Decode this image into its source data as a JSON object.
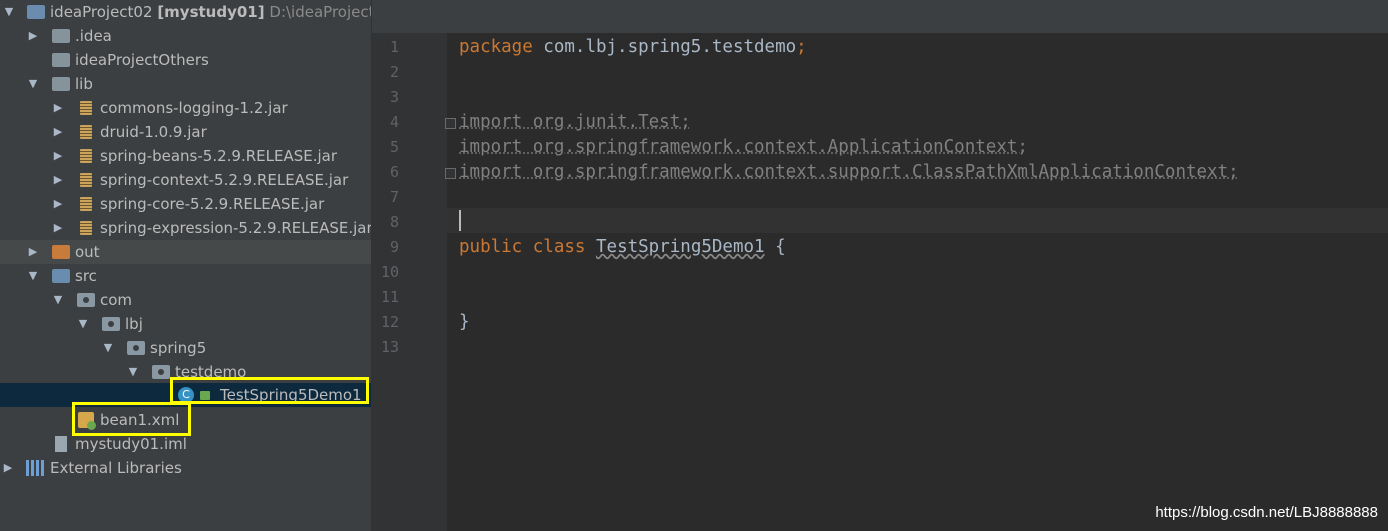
{
  "project": {
    "name": "ideaProject02",
    "module": "[mystudy01]",
    "path": "D:\\ideaProjectT"
  },
  "tree": {
    "idea": ".idea",
    "others": "ideaProjectOthers",
    "lib": "lib",
    "jars": [
      "commons-logging-1.2.jar",
      "druid-1.0.9.jar",
      "spring-beans-5.2.9.RELEASE.jar",
      "spring-context-5.2.9.RELEASE.jar",
      "spring-core-5.2.9.RELEASE.jar",
      "spring-expression-5.2.9.RELEASE.jar"
    ],
    "out": "out",
    "src": "src",
    "com": "com",
    "lbj": "lbj",
    "spring5": "spring5",
    "testdemo": "testdemo",
    "class_file": "TestSpring5Demo1",
    "bean_file": "bean1.xml",
    "iml_file": "mystudy01.iml",
    "external": "External Libraries",
    "class_icon_letter": "C"
  },
  "editor": {
    "line_numbers": [
      "1",
      "2",
      "3",
      "4",
      "5",
      "6",
      "7",
      "8",
      "9",
      "10",
      "11",
      "12",
      "13"
    ],
    "line1": {
      "kw": "package",
      "rest": " com.lbj.spring5.testdemo",
      "semi": ";"
    },
    "imports": [
      "import org.junit.Test;",
      "import org.springframework.context.ApplicationContext;",
      "import org.springframework.context.support.ClassPathXmlApplicationContext;"
    ],
    "line9": {
      "kw1": "public",
      "kw2": "class",
      "name": "TestSpring5Demo1",
      "brace": " {"
    },
    "line12": "}"
  },
  "watermark": "https://blog.csdn.net/LBJ8888888",
  "colors": {
    "highlight_box": "#ffff00",
    "keyword": "#cc7832",
    "selection": "#0d293e"
  }
}
